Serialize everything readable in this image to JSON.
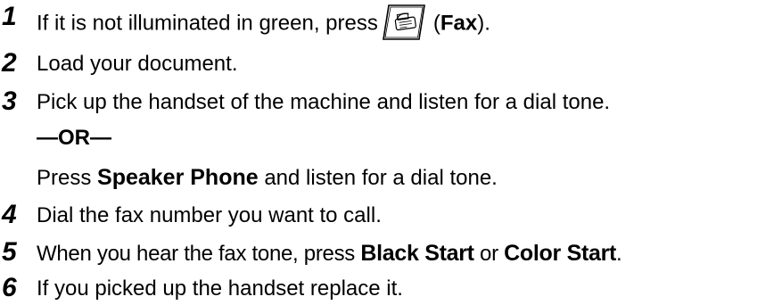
{
  "steps": [
    {
      "number": "1",
      "before": "If it is not illuminated in green, press",
      "after_open": "(",
      "key_label": "Fax",
      "after_close": ")."
    },
    {
      "number": "2",
      "text": "Load your document."
    },
    {
      "number": "3",
      "text": "Pick up the handset of the machine and listen for a dial tone.",
      "or_text": "—OR—",
      "alt_prefix": "Press ",
      "alt_key": "Speaker Phone",
      "alt_suffix": " and listen for a dial tone."
    },
    {
      "number": "4",
      "text": "Dial the fax number you want to call."
    },
    {
      "number": "5",
      "prefix": "When you hear the fax tone, press ",
      "key1": "Black Start",
      "middle": " or ",
      "key2": "Color Start",
      "suffix": "."
    },
    {
      "number": "6",
      "text": "If you picked up the handset replace it."
    }
  ],
  "icons": {
    "fax_key": "fax-machine-icon"
  }
}
